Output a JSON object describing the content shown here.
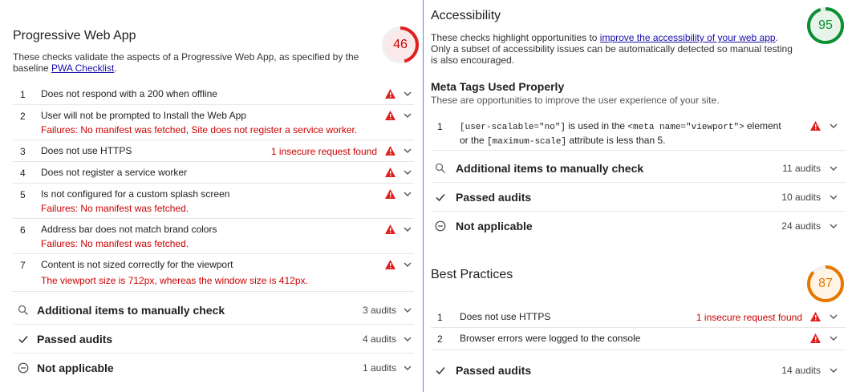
{
  "colors": {
    "fail": "#cc0000",
    "average": "#e67700",
    "pass": "#0a8f31",
    "link": "#1a0dab"
  },
  "pwa": {
    "title": "Progressive Web App",
    "score": "46",
    "desc_prefix": "These checks validate the aspects of a Progressive Web App, as specified by the baseline ",
    "desc_link": "PWA Checklist",
    "desc_suffix": ".",
    "audits": [
      {
        "num": "1",
        "title": "Does not respond with a 200 when offline",
        "failure": "",
        "display": ""
      },
      {
        "num": "2",
        "title": "User will not be prompted to Install the Web App",
        "failure": "Failures: No manifest was fetched, Site does not register a service worker.",
        "display": ""
      },
      {
        "num": "3",
        "title": "Does not use HTTPS",
        "failure": "",
        "display": "1 insecure request found"
      },
      {
        "num": "4",
        "title": "Does not register a service worker",
        "failure": "",
        "display": ""
      },
      {
        "num": "5",
        "title": "Is not configured for a custom splash screen",
        "failure": "Failures: No manifest was fetched.",
        "display": ""
      },
      {
        "num": "6",
        "title": "Address bar does not match brand colors",
        "failure": "Failures: No manifest was fetched.",
        "display": ""
      },
      {
        "num": "7",
        "title": "Content is not sized correctly for the viewport",
        "failure": "The viewport size is 712px, whereas the window size is 412px.",
        "display": ""
      }
    ],
    "groups": [
      {
        "icon": "search-icon",
        "label": "Additional items to manually check",
        "count": "3 audits"
      },
      {
        "icon": "check-icon",
        "label": "Passed audits",
        "count": "4 audits"
      },
      {
        "icon": "minus-circle-icon",
        "label": "Not applicable",
        "count": "1 audits"
      }
    ]
  },
  "accessibility": {
    "title": "Accessibility",
    "score": "95",
    "desc_prefix": "These checks highlight opportunities to ",
    "desc_link": "improve the accessibility of your web app",
    "desc_suffix": ". Only a subset of accessibility issues can be automatically detected so manual testing is also encouraged.",
    "subgroup_title": "Meta Tags Used Properly",
    "subgroup_desc": "These are opportunities to improve the user experience of your site.",
    "audit": {
      "num": "1",
      "code1": "[user-scalable=\"no\"]",
      "text1": " is used in the ",
      "code2": "<meta name=\"viewport\">",
      "text2": " element",
      "text3": "or the ",
      "code3": "[maximum-scale]",
      "text4": " attribute is less than 5."
    },
    "groups": [
      {
        "icon": "search-icon",
        "label": "Additional items to manually check",
        "count": "11 audits"
      },
      {
        "icon": "check-icon",
        "label": "Passed audits",
        "count": "10 audits"
      },
      {
        "icon": "minus-circle-icon",
        "label": "Not applicable",
        "count": "24 audits"
      }
    ]
  },
  "best_practices": {
    "title": "Best Practices",
    "score": "87",
    "audits": [
      {
        "num": "1",
        "title": "Does not use HTTPS",
        "display": "1 insecure request found"
      },
      {
        "num": "2",
        "title": "Browser errors were logged to the console",
        "display": ""
      }
    ],
    "groups": [
      {
        "icon": "check-icon",
        "label": "Passed audits",
        "count": "14 audits"
      }
    ]
  }
}
